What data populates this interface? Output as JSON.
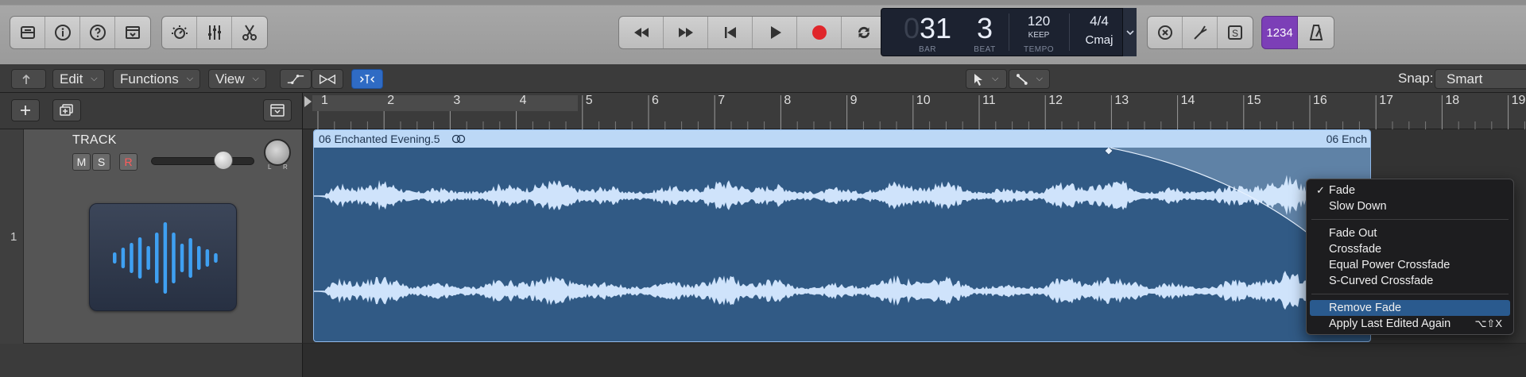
{
  "lcd": {
    "bar_ghost": "0",
    "bar": "31",
    "beat": "3",
    "bar_label": "BAR",
    "beat_label": "BEAT",
    "tempo": "120",
    "tempo_mode": "KEEP",
    "tempo_label": "TEMPO",
    "time_signature": "4/4",
    "key": "Cmaj"
  },
  "control_bar": {
    "count_in": "1234"
  },
  "toolbar": {
    "edit": "Edit",
    "functions": "Functions",
    "view": "View",
    "snap_label": "Snap:",
    "snap_value": "Smart"
  },
  "ruler": {
    "bars": [
      "1",
      "2",
      "3",
      "4",
      "5",
      "6",
      "7",
      "8",
      "9",
      "10",
      "11",
      "12",
      "13",
      "14",
      "15",
      "16",
      "17",
      "18",
      "19"
    ]
  },
  "track": {
    "number": "1",
    "name": "TRACK",
    "mute": "M",
    "solo": "S",
    "record": "R",
    "pan_left": "L",
    "pan_right": "R"
  },
  "region": {
    "name": "06 Enchanted Evening.5",
    "name_right": "06 Ench"
  },
  "context_menu": {
    "items": [
      {
        "label": "Fade",
        "checked": true
      },
      {
        "label": "Slow Down"
      },
      {
        "label": "Fade Out"
      },
      {
        "label": "Crossfade"
      },
      {
        "label": "Equal Power Crossfade"
      },
      {
        "label": "S-Curved Crossfade"
      },
      {
        "label": "Remove Fade",
        "highlighted": true
      },
      {
        "label": "Apply Last Edited Again",
        "shortcut": "⌥⇧X"
      }
    ]
  },
  "colors": {
    "region_body": "#315a85",
    "region_header": "#bcd8f6",
    "waveform": "#cfe3fb",
    "count_in": "#7c3fb7",
    "record": "#e0262b",
    "menu_highlight": "#2a5a8e"
  }
}
